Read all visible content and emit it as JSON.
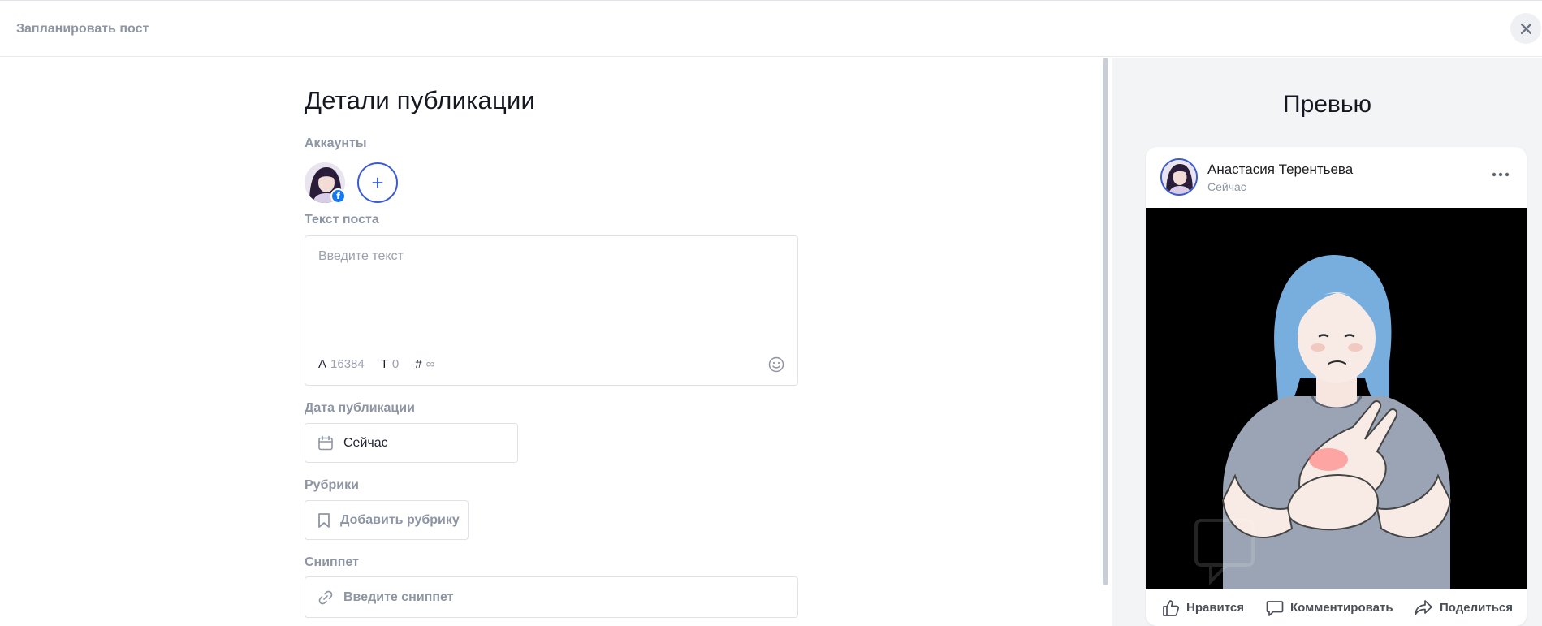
{
  "header": {
    "title": "Запланировать пост"
  },
  "form": {
    "heading": "Детали публикации",
    "accounts_label": "Аккаунты",
    "account_network": "f",
    "text_label": "Текст поста",
    "text_placeholder": "Введите текст",
    "counters": [
      {
        "key": "A",
        "value": "16384"
      },
      {
        "key": "T",
        "value": "0"
      },
      {
        "key": "#",
        "value": "∞"
      }
    ],
    "date_label": "Дата публикации",
    "date_value": "Сейчас",
    "rubrics_label": "Рубрики",
    "rubric_button": "Добавить рубрику",
    "snippet_label": "Сниппет",
    "snippet_placeholder": "Введите сниппет"
  },
  "preview": {
    "title": "Превью",
    "author": "Анастасия Терентьева",
    "time": "Сейчас",
    "actions": {
      "like": "Нравится",
      "comment": "Комментировать",
      "share": "Поделиться"
    }
  },
  "colors": {
    "accent": "#3b5bd6",
    "muted": "#8e95a3",
    "facebook": "#1877f2"
  }
}
